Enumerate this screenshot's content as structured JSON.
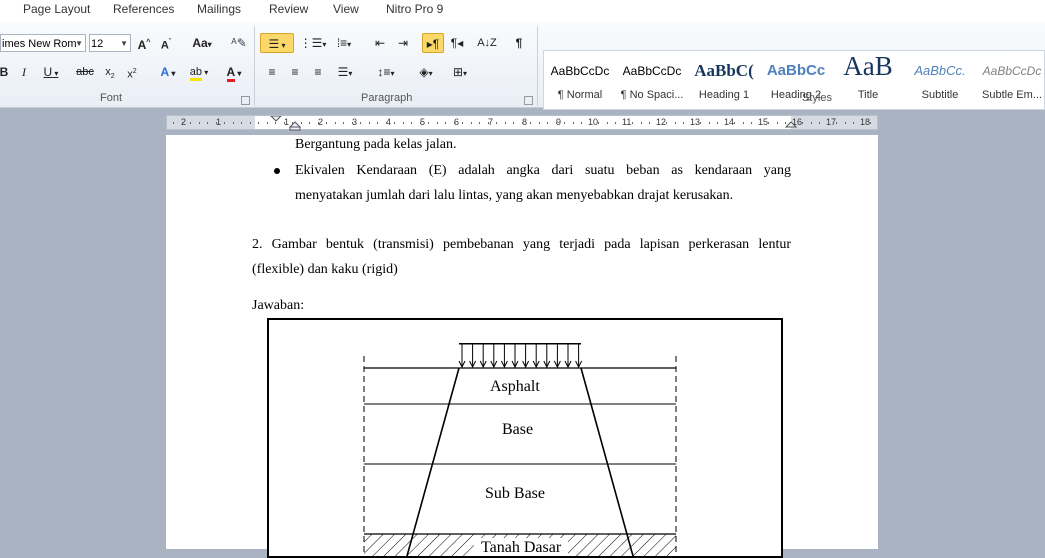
{
  "menu_tabs": [
    "Page Layout",
    "References",
    "Mailings",
    "Review",
    "View",
    "Nitro Pro 9"
  ],
  "font": {
    "name": "imes New Rom",
    "size": "12"
  },
  "groups": {
    "font": "Font",
    "paragraph": "Paragraph",
    "styles": "Styles"
  },
  "styles": [
    {
      "sample": "AaBbCcDc",
      "name": "¶ Normal"
    },
    {
      "sample": "AaBbCcDc",
      "name": "¶ No Spaci..."
    },
    {
      "sample": "AaBbC(",
      "name": "Heading 1"
    },
    {
      "sample": "AaBbCc",
      "name": "Heading 2"
    },
    {
      "sample": "AaB",
      "name": "Title"
    },
    {
      "sample": "AaBbCc.",
      "name": "Subtitle"
    },
    {
      "sample": "AaBbCcDc",
      "name": "Subtle Em..."
    }
  ],
  "ruler": {
    "left_numbers": [
      "2",
      "1"
    ],
    "numbers": [
      "1",
      "2",
      "3",
      "4",
      "5",
      "6",
      "7",
      "8",
      "9",
      "10",
      "11",
      "12",
      "13",
      "14",
      "15",
      "16",
      "17",
      "18"
    ]
  },
  "document": {
    "line1": "Bergantung  pada kelas jalan.",
    "bullet_line1": "Ekivalen  Kendaraan  (E)  adalah  angka  dari  suatu  beban  as  kendaraan  yang",
    "bullet_line2": "menyatakan jumlah dari lalu lintas, yang akan menyebabkan drajat kerusakan.",
    "q2_line1": "2.  Gambar  bentuk  (transmisi)  pembebanan  yang  terjadi  pada  lapisan  perkerasan  lentur",
    "q2_line2": "(flexible) dan kaku (rigid)",
    "answer_label": "Jawaban:"
  },
  "figure": {
    "layers": [
      "Asphalt",
      "Base",
      "Sub Base",
      "Tanah Dasar"
    ]
  }
}
